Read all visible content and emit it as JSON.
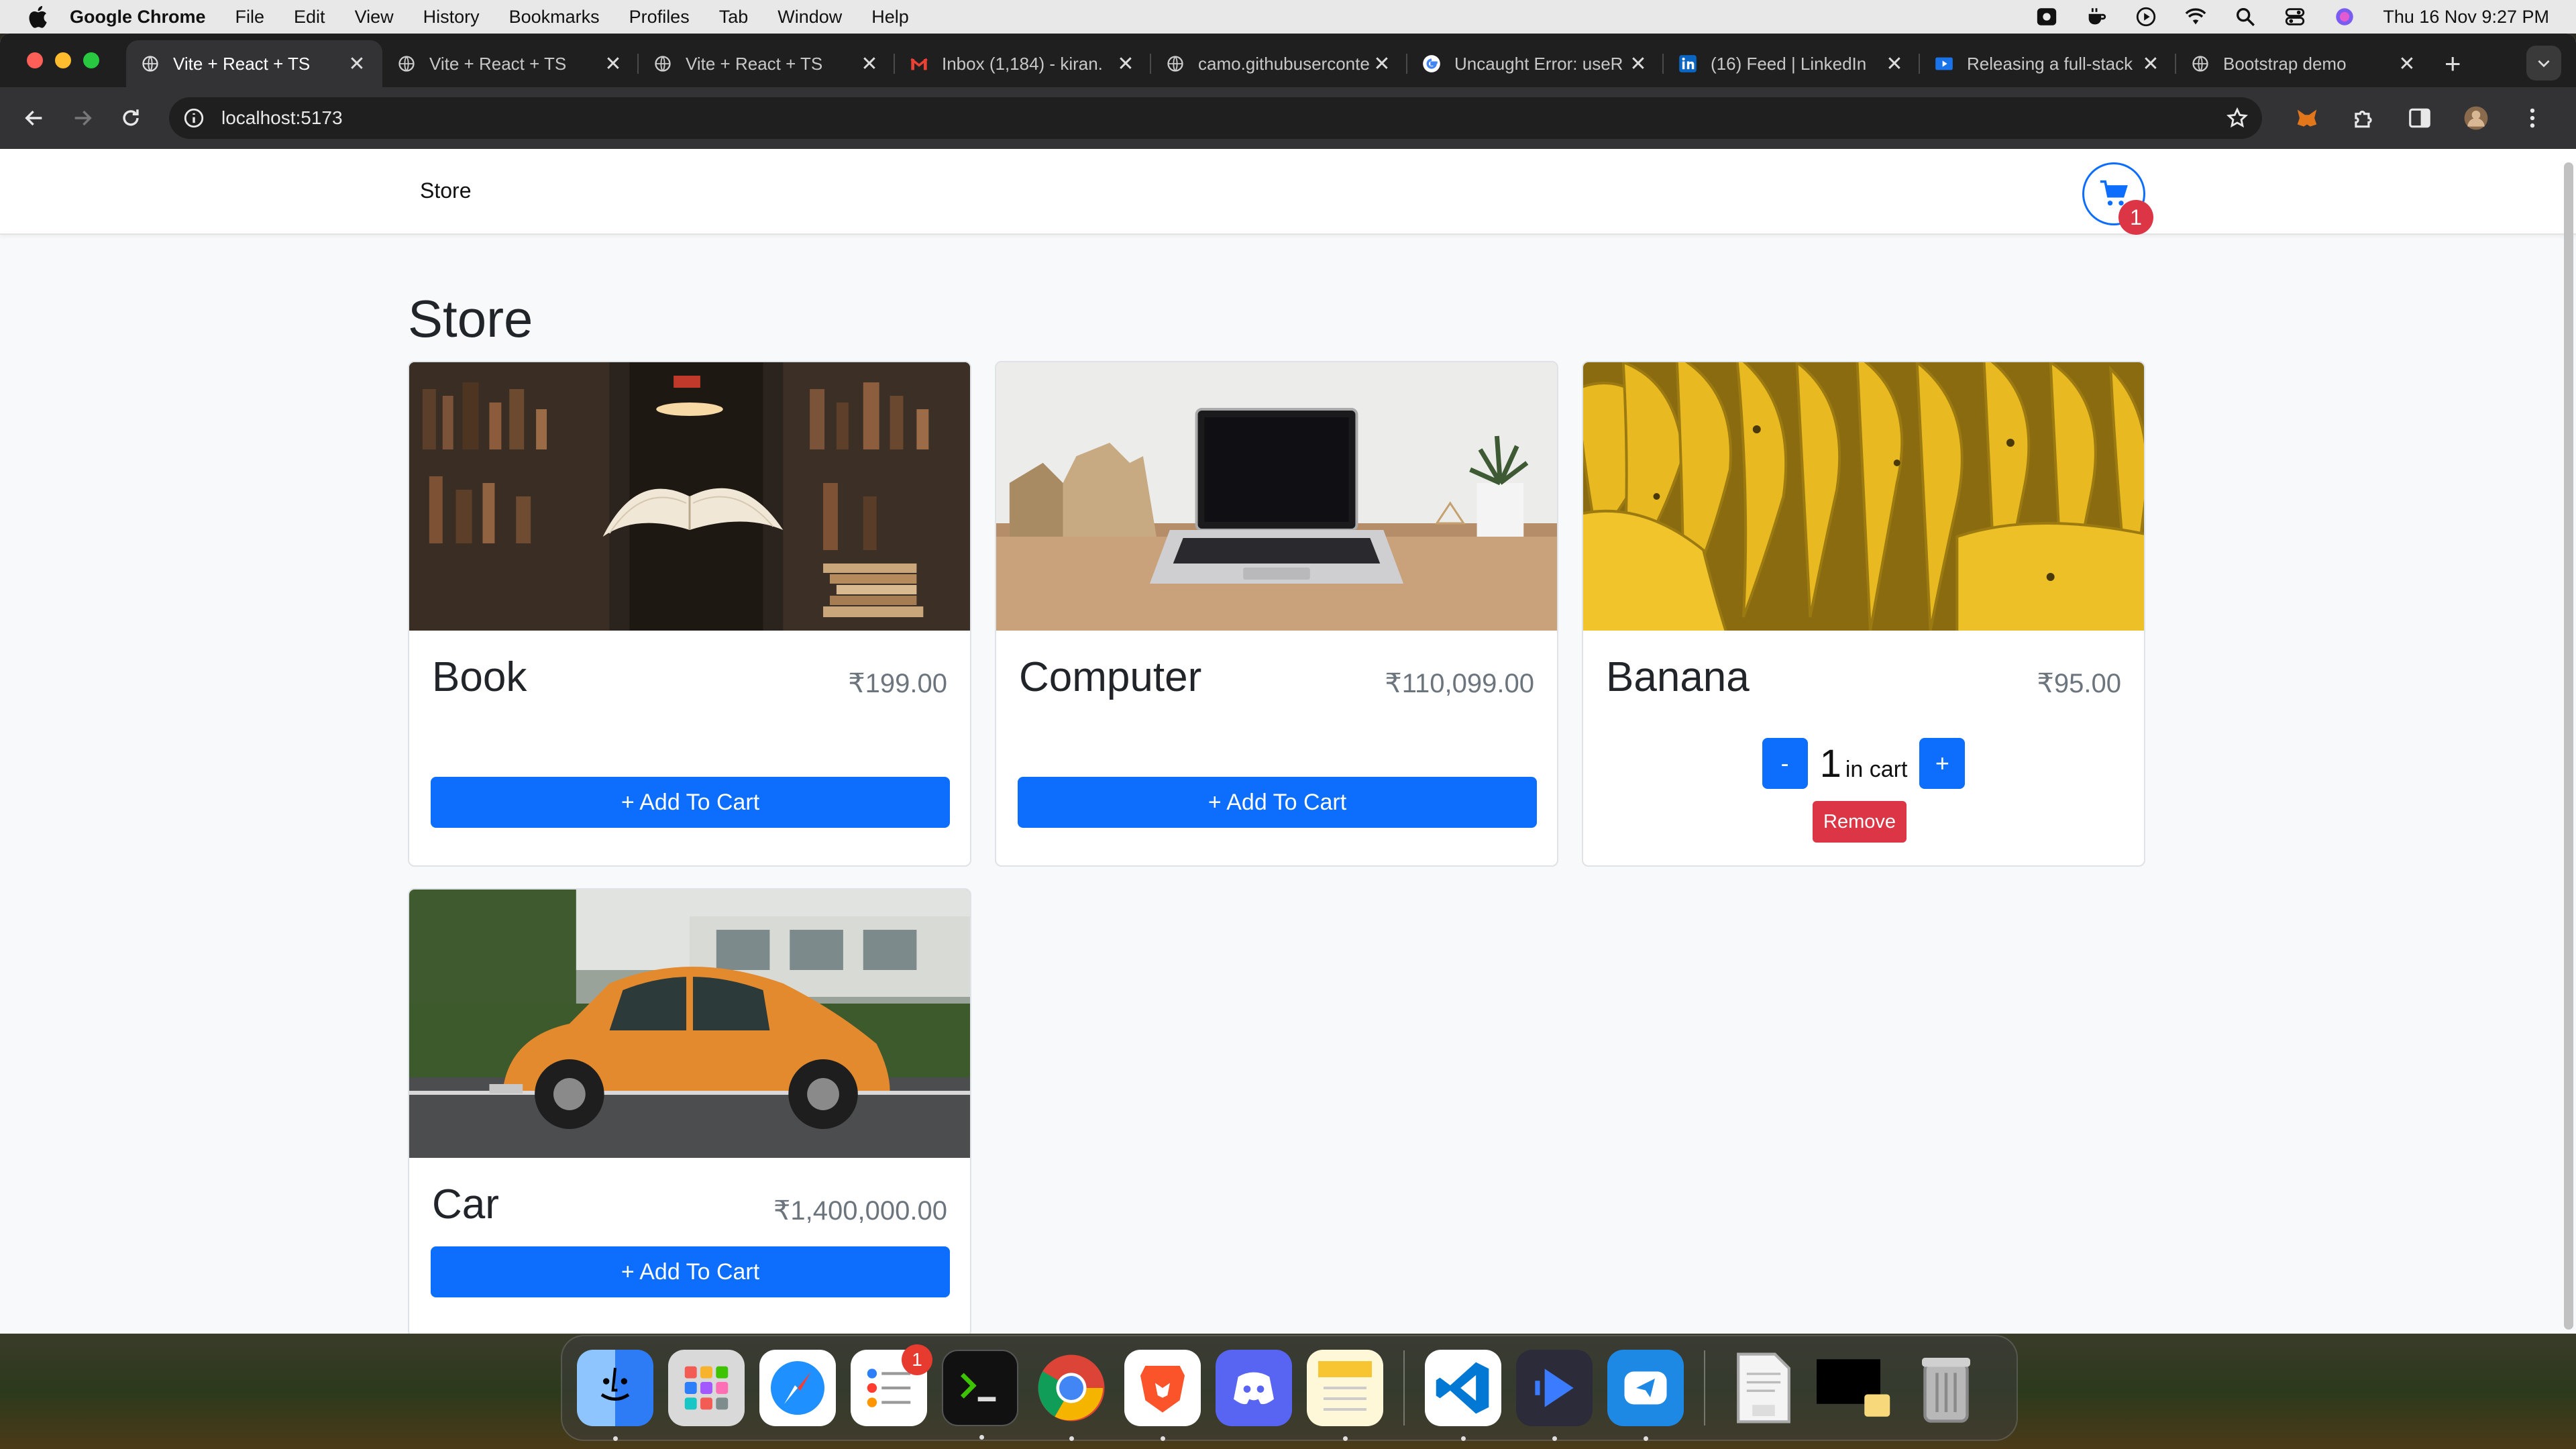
{
  "menubar": {
    "app_name": "Google Chrome",
    "items": [
      "File",
      "Edit",
      "View",
      "History",
      "Bookmarks",
      "Profiles",
      "Tab",
      "Window",
      "Help"
    ],
    "clock": "Thu 16 Nov  9:27 PM"
  },
  "browser": {
    "tabs": [
      {
        "title": "Vite + React + TS",
        "icon": "globe-icon",
        "active": true
      },
      {
        "title": "Vite + React + TS",
        "icon": "globe-icon"
      },
      {
        "title": "Vite + React + TS",
        "icon": "globe-icon"
      },
      {
        "title": "Inbox (1,184) - kiran.",
        "icon": "gmail-icon"
      },
      {
        "title": "camo.githubuserconte",
        "icon": "globe-icon"
      },
      {
        "title": "Uncaught Error: useR",
        "icon": "google-icon"
      },
      {
        "title": "(16) Feed | LinkedIn",
        "icon": "linkedin-icon"
      },
      {
        "title": "Releasing a full-stack",
        "icon": "video-icon"
      },
      {
        "title": "Bootstrap demo",
        "icon": "globe-icon"
      }
    ],
    "new_tab": "+",
    "url": "localhost:5173"
  },
  "store": {
    "brand": "Store",
    "title": "Store",
    "cart_count": "1",
    "products": [
      {
        "name": "Book",
        "price": "₹199.00",
        "button": "+ Add To Cart"
      },
      {
        "name": "Computer",
        "price": "₹110,099.00",
        "button": "+ Add To Cart"
      },
      {
        "name": "Banana",
        "price": "₹95.00",
        "quantity": "1",
        "qty_label": "in cart",
        "minus": "-",
        "plus": "+",
        "remove": "Remove"
      },
      {
        "name": "Car",
        "price": "₹1,400,000.00",
        "button": "+ Add To Cart"
      }
    ]
  },
  "colors": {
    "primary": "#0d6efd",
    "danger": "#dc3545",
    "page_bg": "#f8f9fa",
    "chrome_dark": "#1f1f1f"
  },
  "dock": {
    "apps": [
      "finder-icon",
      "launchpad-icon",
      "safari-icon",
      "reminders-icon",
      "terminal-icon",
      "chrome-icon",
      "brave-icon",
      "discord-icon",
      "notes-icon",
      "vscode-icon",
      "voice-app-icon",
      "cursor-app-icon",
      "pdf-file-icon",
      "screenshot-icon",
      "trash-icon"
    ],
    "reminders_badge": "1"
  }
}
